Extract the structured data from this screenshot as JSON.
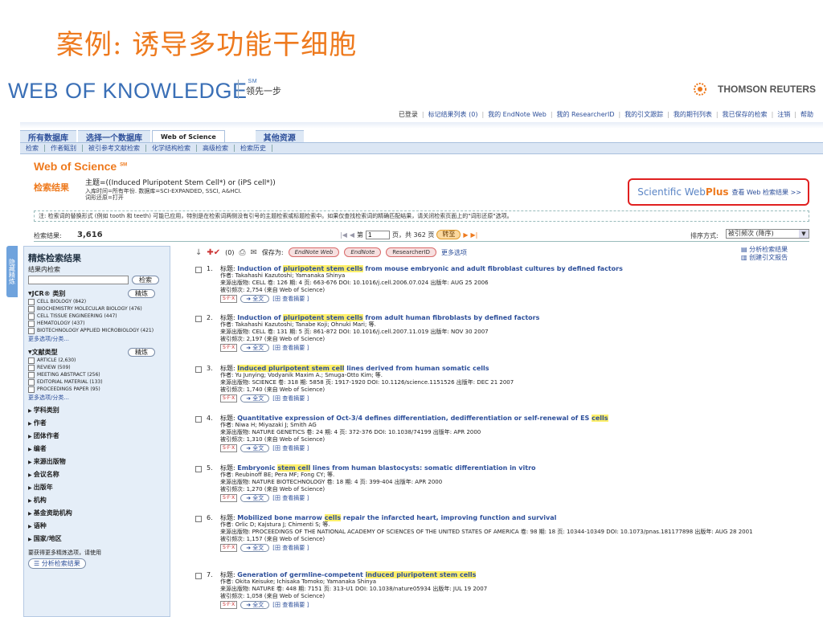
{
  "slide_title": "案例: 诱导多功能干细胞",
  "brand": {
    "name": "WEB OF KNOWLEDGE",
    "sm": "SM",
    "tagline": "领先一步",
    "publisher": "THOMSON REUTERS"
  },
  "top_links": [
    "已登录",
    "标记结果列表 (0)",
    "我的 EndNote Web",
    "我的 ResearcherID",
    "我的引文跟踪",
    "我的期刊列表",
    "我已保存的检索",
    "注销",
    "帮助"
  ],
  "tabs": [
    "所有数据库",
    "选择一个数据库",
    "Web of Science",
    "其他资源"
  ],
  "subnav": [
    "检索",
    "作者甄别",
    "被引参考文献检索",
    "化学结构检索",
    "高级检索",
    "检索历史"
  ],
  "wos": {
    "name": "Web of Science",
    "sm": "SM"
  },
  "query": {
    "label": "检索结果",
    "text": "主题=((Induced Pluripotent Stem Cell*) or (iPS cell*))",
    "line1": "入库时间=所有年份. 数据库=SCI-EXPANDED, SSCI, A&HCI.",
    "line2": "词形还原=打开"
  },
  "webplus": {
    "brand_a": "Scientific Web",
    "brand_b": "Plus",
    "link": "查看 Web 检索结果 >>"
  },
  "note": "注: 检索词的替换形式 (例如 tooth 和 teeth) 可能已应用，特别是在检索词两侧没有引号的主题检索或标题检索中。如果仅查找检索词的精确匹配结果，请关闭检索页面上的\"词形还原\"选项。",
  "results": {
    "label": "检索结果:",
    "count": "3,616",
    "page_prefix": "第",
    "page": "1",
    "page_suffix": "页，共 362 页",
    "go": "转至",
    "sort_label": "排序方式:",
    "sort_value": "被引频次 (降序)"
  },
  "sidebar": {
    "vtab": "隐藏精炼",
    "title": "精炼检索结果",
    "within": "结果内检索",
    "search_btn": "检索",
    "refine_btn": "精炼",
    "jcr": {
      "title": "JCR® 类别",
      "items": [
        "CELL BIOLOGY (842)",
        "BIOCHEMISTRY MOLECULAR BIOLOGY (476)",
        "CELL TISSUE ENGINEERING (447)",
        "HEMATOLOGY (437)",
        "BIOTECHNOLOGY APPLIED MICROBIOLOGY (421)"
      ],
      "more": "更多选项/分类..."
    },
    "doctype": {
      "title": "文献类型",
      "items": [
        "ARTICLE (2,630)",
        "REVIEW (509)",
        "MEETING ABSTRACT (256)",
        "EDITORIAL MATERIAL (133)",
        "PROCEEDINGS PAPER (95)"
      ],
      "more": "更多选项/分类..."
    },
    "collapsed": [
      "学科类别",
      "作者",
      "团体作者",
      "编者",
      "来源出版物",
      "会议名称",
      "出版年",
      "机构",
      "基金资助机构",
      "语种",
      "国家/地区"
    ],
    "footer": "要获得更多精炼选项，请使用",
    "analyze_btn": "分析检索结果"
  },
  "toolbar": {
    "count": "(0)",
    "save_to": "保存为:",
    "endnote_web": "EndNote Web",
    "endnote": "EndNote",
    "researcherid": "ResearcherID",
    "more": "更多选项",
    "analyze": "分析检索结果",
    "citation_report": "创建引文报告"
  },
  "labels": {
    "fulltext": "全文",
    "abstract": "[田 查看摘要 ]",
    "sfx": "S·F·X"
  },
  "records": [
    {
      "num": "1.",
      "pre": "Induction of ",
      "hl": "pluripotent stem cells",
      "post": " from mouse embryonic and adult fibroblast cultures by defined factors",
      "authors": "作者: Takahashi Kazutoshi; Yamanaka Shinya",
      "source": "来源出版物: CELL  卷: 126  期: 4  页: 663-676  DOI: 10.1016/j.cell.2006.07.024  出版年: AUG 25 2006",
      "cited": "被引频次: 2,754 (来自 Web of Science)"
    },
    {
      "num": "2.",
      "pre": "Induction of ",
      "hl": "pluripotent stem cells",
      "post": " from adult human fibroblasts by defined factors",
      "authors": "作者: Takahashi Kazutoshi; Tanabe Koji; Ohnuki Mari; 等.",
      "source": "来源出版物: CELL  卷: 131  期: 5  页: 861-872  DOI: 10.1016/j.cell.2007.11.019  出版年: NOV 30 2007",
      "cited": "被引频次: 2,197 (来自 Web of Science)"
    },
    {
      "num": "3.",
      "pre": "",
      "hl": "Induced pluripotent stem cell",
      "post": " lines derived from human somatic cells",
      "authors": "作者: Yu Junying; Vodyanik Maxim A.; Smuga-Otto Kim; 等.",
      "source": "来源出版物: SCIENCE  卷: 318  期: 5858  页: 1917-1920  DOI: 10.1126/science.1151526  出版年: DEC 21 2007",
      "cited": "被引频次: 1,740 (来自 Web of Science)"
    },
    {
      "num": "4.",
      "pre": "Quantitative expression of Oct-3/4 defines differentiation, dedifferentiation or self-renewal of ES ",
      "hl": "cells",
      "post": "",
      "authors": "作者: Niwa H; Miyazaki J; Smith AG",
      "source": "来源出版物: NATURE GENETICS  卷: 24  期: 4  页: 372-376  DOI: 10.1038/74199  出版年: APR 2000",
      "cited": "被引频次: 1,310 (来自 Web of Science)"
    },
    {
      "num": "5.",
      "pre": "Embryonic ",
      "hl": "stem cell",
      "post": " lines from human blastocysts: somatic differentiation in vitro",
      "authors": "作者: Reubinoff BE; Pera MF; Fong CY; 等.",
      "source": "来源出版物: NATURE BIOTECHNOLOGY  卷: 18  期: 4  页: 399-404  出版年: APR 2000",
      "cited": "被引频次: 1,270 (来自 Web of Science)"
    },
    {
      "num": "6.",
      "pre": "Mobilized bone marrow ",
      "hl": "cells",
      "post": " repair the infarcted heart, improving function and survival",
      "authors": "作者: Orlic D; Kajstura J; Chimenti S; 等.",
      "source": "来源出版物: PROCEEDINGS OF THE NATIONAL ACADEMY OF SCIENCES OF THE UNITED STATES OF AMERICA  卷: 98  期: 18  页: 10344-10349  DOI: 10.1073/pnas.181177898  出版年: AUG 28 2001",
      "cited": "被引频次: 1,157 (来自 Web of Science)"
    },
    {
      "num": "7.",
      "pre": "Generation of germline-competent ",
      "hl": "induced pluripotent stem cells",
      "post": "",
      "authors": "作者: Okita Keisuke; Ichisaka Tomoko; Yamanaka Shinya",
      "source": "来源出版物: NATURE  卷: 448  期: 7151  页: 313-U1  DOI: 10.1038/nature05934  出版年: JUL 19 2007",
      "cited": "被引频次: 1,058 (来自 Web of Science)"
    }
  ]
}
